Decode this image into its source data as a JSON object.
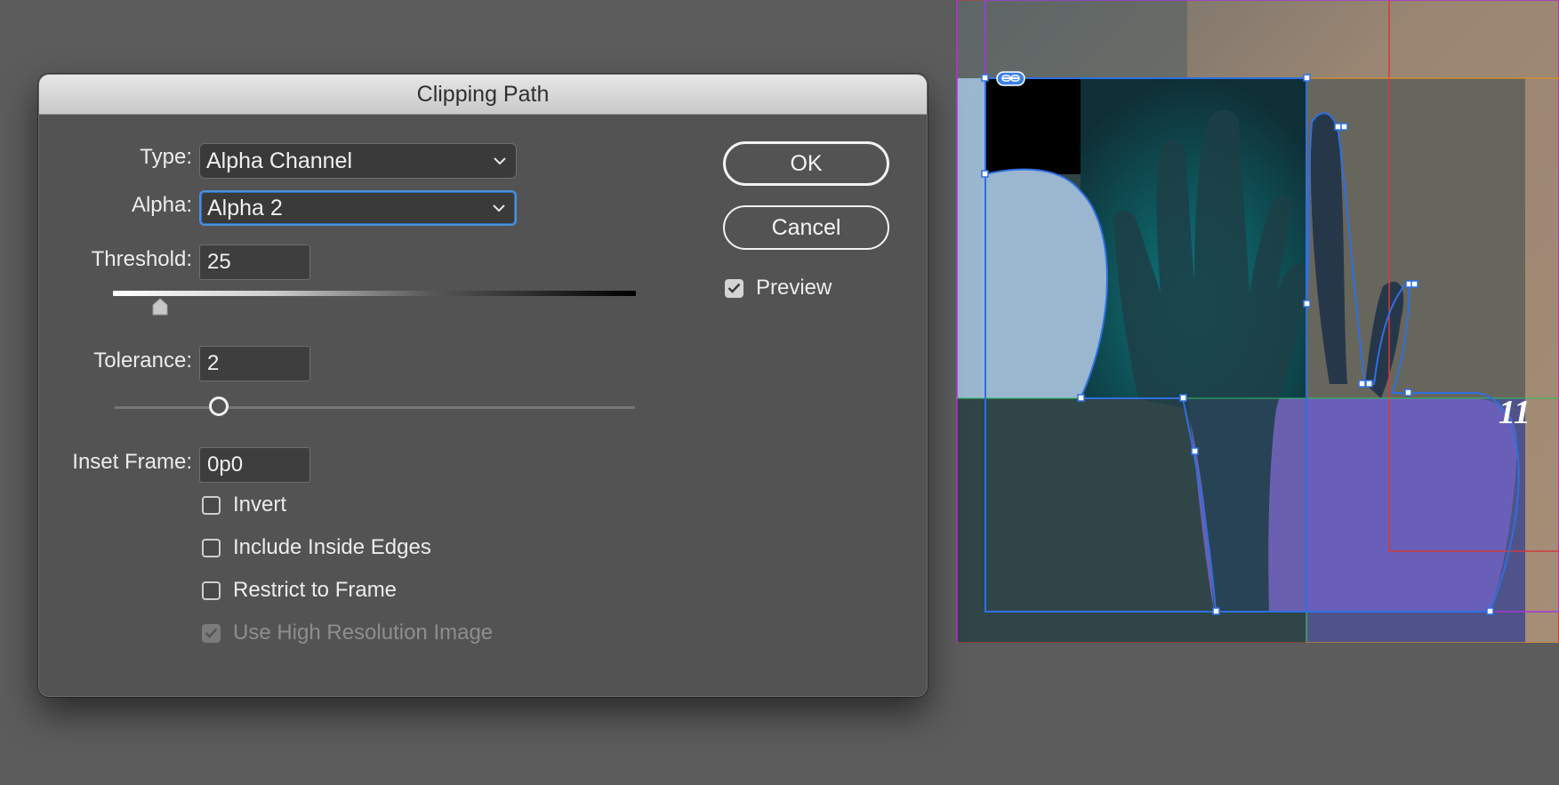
{
  "dialog": {
    "title": "Clipping Path",
    "type": {
      "label": "Type:",
      "value": "Alpha Channel"
    },
    "alpha": {
      "label": "Alpha:",
      "value": "Alpha 2"
    },
    "threshold": {
      "label": "Threshold:",
      "value": "25",
      "slider_fraction": 0.09
    },
    "tolerance": {
      "label": "Tolerance:",
      "value": "2",
      "slider_fraction": 0.2
    },
    "inset_frame": {
      "label": "Inset Frame:",
      "value": "0p0"
    },
    "options": [
      {
        "label": "Invert",
        "checked": false,
        "disabled": false
      },
      {
        "label": "Include Inside Edges",
        "checked": false,
        "disabled": false
      },
      {
        "label": "Restrict to Frame",
        "checked": false,
        "disabled": false
      },
      {
        "label": "Use High Resolution Image",
        "checked": true,
        "disabled": true
      }
    ],
    "ok_label": "OK",
    "cancel_label": "Cancel",
    "preview": {
      "label": "Preview",
      "checked": true
    }
  },
  "canvas": {
    "page_text": "11",
    "icons": {
      "link": "link-icon",
      "chevron": "chevron-down-icon",
      "check": "checkmark-icon"
    },
    "colors": {
      "selection": "#2f6fe0",
      "margin_guide": "#d33a3a",
      "bleed_guide": "#e0902a",
      "frame_guide": "#a23ad6",
      "clip_fill": "#9ab7cf",
      "overlay_fill": "#7a66c9"
    }
  }
}
